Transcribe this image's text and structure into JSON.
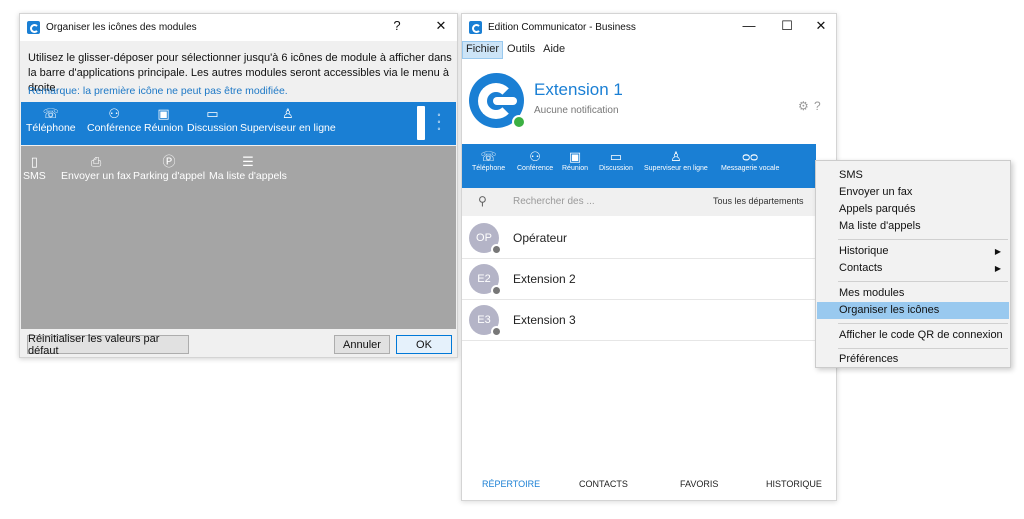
{
  "dialog": {
    "title": "Organiser les icônes des modules",
    "help_label": "?",
    "close_label": "✕",
    "description": "Utilisez le glisser-déposer pour sélectionner jusqu'à 6 icônes de module à afficher dans la barre d'applications principale. Les autres modules seront accessibles via le menu à droite.",
    "note": "Remarque: la première icône ne peut pas être modifiée.",
    "selected_modules": [
      {
        "label": "Téléphone",
        "icon": "phone-icon",
        "glyph": "☏"
      },
      {
        "label": "Conférence",
        "icon": "conference-icon",
        "glyph": "⚇"
      },
      {
        "label": "Réunion",
        "icon": "meeting-icon",
        "glyph": "▣"
      },
      {
        "label": "Discussion",
        "icon": "chat-icon",
        "glyph": "▭"
      },
      {
        "label": "Superviseur en ligne",
        "icon": "supervisor-icon",
        "glyph": "♙"
      }
    ],
    "available_modules": [
      {
        "label": "SMS",
        "icon": "sms-icon",
        "glyph": "▯"
      },
      {
        "label": "Envoyer un fax",
        "icon": "fax-icon",
        "glyph": "⎙"
      },
      {
        "label": "Parking d'appel",
        "icon": "parking-icon",
        "glyph": "Ⓟ"
      },
      {
        "label": "Ma liste d'appels",
        "icon": "call-list-icon",
        "glyph": "☰"
      }
    ],
    "more_glyph": "∘∘∘",
    "reset_label": "Réinitialiser les valeurs par défaut",
    "cancel_label": "Annuler",
    "ok_label": "OK"
  },
  "main": {
    "title": "Edition Communicator - Business",
    "min_label": "—",
    "max_label": "☐",
    "close_label": "✕",
    "menu": [
      "Fichier",
      "Outils",
      "Aide"
    ],
    "extension_title": "Extension 1",
    "notification": "Aucune notification",
    "settings_glyph": "⚙",
    "help_glyph": "?",
    "nav": [
      {
        "label": "Téléphone",
        "icon": "phone-icon",
        "glyph": "☏"
      },
      {
        "label": "Conférence",
        "icon": "conference-icon",
        "glyph": "⚇"
      },
      {
        "label": "Réunion",
        "icon": "meeting-icon",
        "glyph": "▣"
      },
      {
        "label": "Discussion",
        "icon": "chat-icon",
        "glyph": "▭"
      },
      {
        "label": "Superviseur en ligne",
        "icon": "supervisor-icon",
        "glyph": "♙"
      },
      {
        "label": "Messagerie vocale",
        "icon": "voicemail-icon",
        "glyph": "ᴑᴑ"
      }
    ],
    "search_glyph": "⚲",
    "search_placeholder": "Rechercher des ...",
    "departments": "Tous les départements",
    "contacts": [
      {
        "initials": "OP",
        "name": "Opérateur"
      },
      {
        "initials": "E2",
        "name": "Extension 2"
      },
      {
        "initials": "E3",
        "name": "Extension 3"
      }
    ],
    "tabs": [
      "RÉPERTOIRE",
      "CONTACTS",
      "FAVORIS",
      "HISTORIQUE"
    ],
    "accent_color": "#1a7fd4"
  },
  "context_menu": {
    "items": [
      "SMS",
      "Envoyer un fax",
      "Appels parqués",
      "Ma liste d'appels",
      "Historique",
      "Contacts",
      "Mes modules",
      "Organiser les icônes",
      "Afficher le code QR de connexion",
      "Préférences"
    ],
    "submenu_arrow": "▶",
    "highlighted": "Organiser les icônes"
  }
}
